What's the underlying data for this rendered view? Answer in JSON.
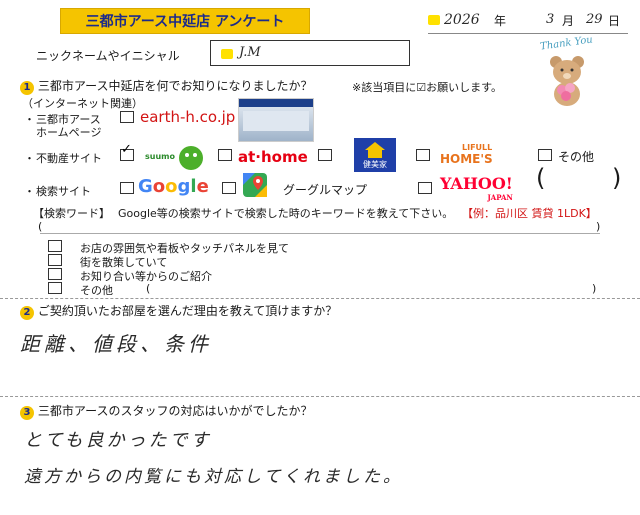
{
  "title": "三都市アース中延店 アンケート",
  "date": {
    "year_val": "2026",
    "year": "年",
    "month_val": "3",
    "month": "月",
    "day_val": "29",
    "day": "日"
  },
  "nickname": {
    "label": "ニックネームやイニシャル",
    "value": "J.M"
  },
  "thank_you": "Thank You",
  "q1": {
    "num": "1",
    "question": "三都市アース中延店を何でお知りになりましたか？",
    "note": "※該当項目に☑お願いします。",
    "internet_label": "（インターネット関連）",
    "homepage_label_1": "三都市アース",
    "homepage_label_2": "ホームページ",
    "homepage_url": "earth-h.co.jp",
    "realestate_label": "不動産サイト",
    "suumo": "suumo",
    "athome": "at·home",
    "kenbiya": "健美家",
    "lifull_1": "LIFULL",
    "lifull_2": "HOME'S",
    "other": "その他",
    "search_label": "検索サイト",
    "google": [
      "G",
      "o",
      "o",
      "g",
      "l",
      "e"
    ],
    "google_colors": [
      "#4285f4",
      "#ea4335",
      "#fbbc05",
      "#4285f4",
      "#34a853",
      "#ea4335"
    ],
    "googlemap": "グーグルマップ",
    "yahoo": "YAHOO!",
    "yahoo_sub": "JAPAN",
    "keyword_label": "【検索ワード】",
    "keyword_text": "Google等の検索サイトで検索した時のキーワードを教えて下さい。",
    "keyword_example": "【例：品川区 賃貸 1LDK】",
    "paren_open": "(",
    "paren_close": ")",
    "offline": [
      "お店の雰囲気や看板やタッチパネルを見て",
      "街を散策していて",
      "お知り合い等からのご紹介",
      "その他"
    ]
  },
  "q2": {
    "num": "2",
    "question": "ご契約頂いたお部屋を選んだ理由を教えて頂けますか？",
    "answer": "距離、値段、条件"
  },
  "q3": {
    "num": "3",
    "question": "三都市アースのスタッフの対応はいかがでしたか？",
    "answer_1": "とても良かったです",
    "answer_2": "遠方からの内覧にも対応してくれました。"
  }
}
